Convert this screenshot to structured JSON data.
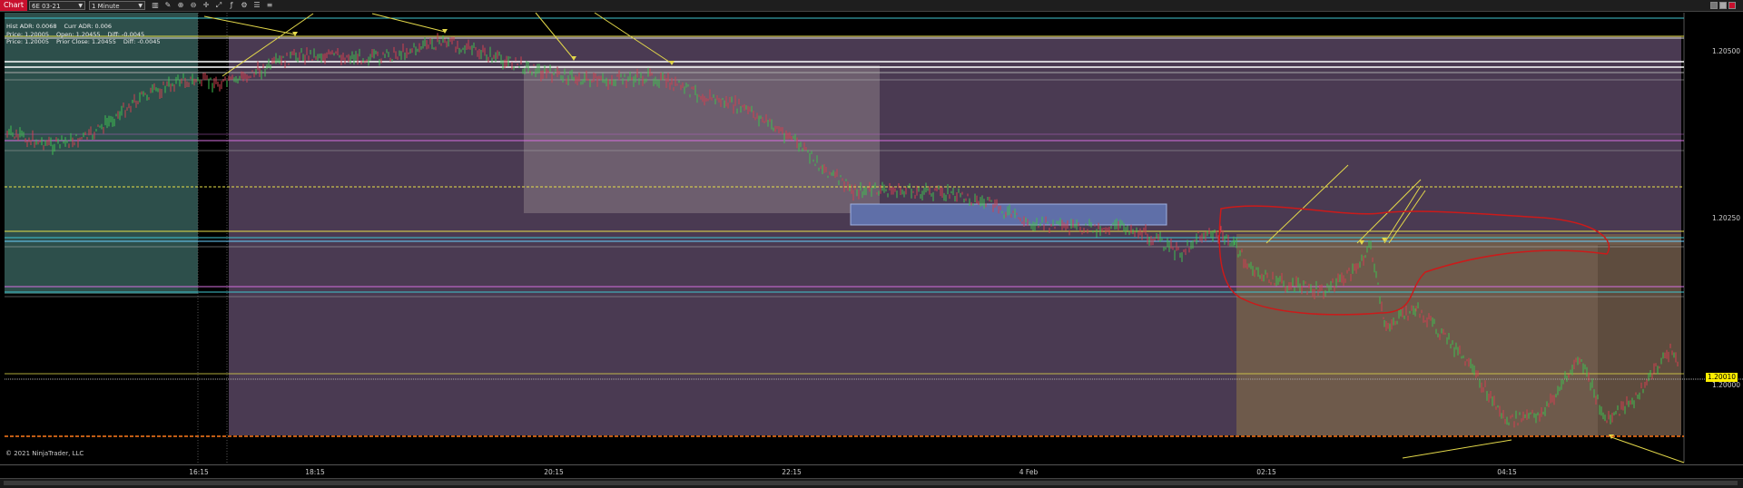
{
  "toolbar": {
    "chart_tab": "Chart",
    "instrument": "6E 03-21",
    "interval": "1 Minute",
    "icons": [
      "bars-icon",
      "pencil-icon",
      "zoom-in-icon",
      "zoom-out-icon",
      "crosshair-icon",
      "drawing-tools-icon",
      "indicators-icon",
      "strategies-icon",
      "properties-icon"
    ]
  },
  "info": {
    "hist_adr": "Hist ADR: 0.0068",
    "curr_adr": "Curr ADR: 0.006",
    "price1": "Price: 1.20005",
    "open": "Open: 1.20455",
    "diff1": "Diff: -0.0045",
    "price2": "Price: 1.20005",
    "prior_close": "Prior Close: 1.20455",
    "diff2": "Diff: -0.0045"
  },
  "y_axis": {
    "labels": [
      "1.20500",
      "1.20250",
      "1.20000"
    ],
    "current_price": "1.20010"
  },
  "x_axis": {
    "ticks": [
      "16:15",
      "18:15",
      "20:15",
      "22:15",
      "4 Feb",
      "02:15",
      "04:15"
    ]
  },
  "copyright": "© 2021 NinjaTrader, LLC",
  "colors": {
    "background": "#000000",
    "zone_purple": "#4a3a52",
    "zone_teal": "#2d4f4b",
    "zone_light": "#6d5e6e",
    "zone_tan": "#6e5a4b",
    "zone_blue": "#5f6fa8",
    "up_bar": "#3fbf50",
    "down_bar": "#d04050",
    "annotation_yellow": "#e3d84a",
    "annotation_red": "#cc1a1a"
  }
}
